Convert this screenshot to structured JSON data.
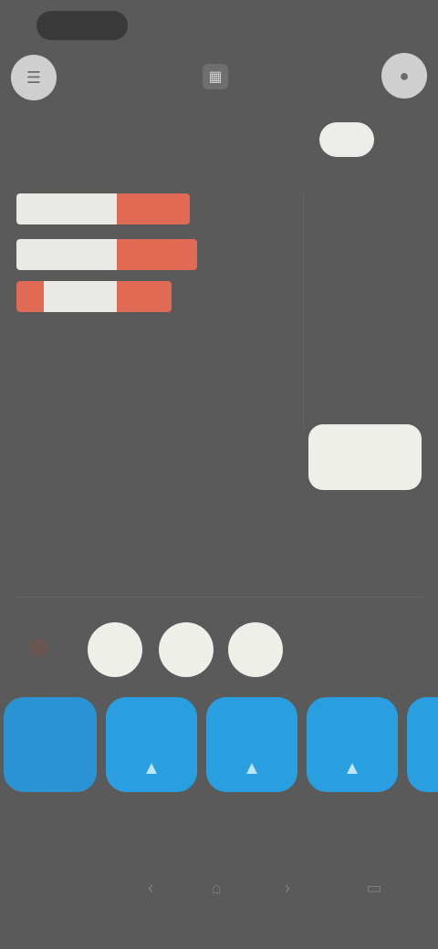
{
  "status": {
    "time": ""
  },
  "header": {
    "title": "",
    "menu_icon": "menu-icon",
    "center_icon": "grid-icon",
    "profile_icon": "profile-icon"
  },
  "stats": {
    "rows": [
      {
        "light": 0.55,
        "red": 0.4
      },
      {
        "light": 0.55,
        "red": 0.43
      },
      {
        "light": 0.55,
        "red": 0.3
      }
    ],
    "footnote": ""
  },
  "right_panel": {
    "pill_label": "",
    "pill_value": "",
    "items": [
      "",
      "",
      ""
    ],
    "action_button": ""
  },
  "tiles": {
    "main_text": "",
    "labels": [
      "",
      "",
      "",
      "",
      ""
    ]
  },
  "colors": {
    "background": "#5a5a5a",
    "accent_blue": "#2a9fe0",
    "accent_red": "#e16a55",
    "light": "#efefe9"
  }
}
